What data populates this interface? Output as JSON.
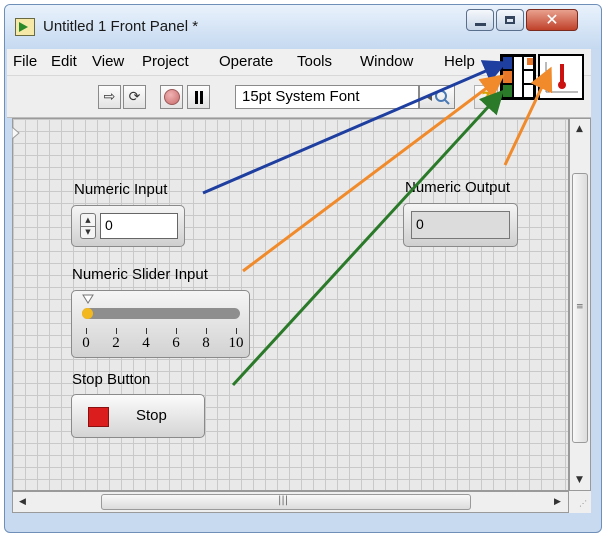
{
  "window": {
    "title": "Untitled 1 Front Panel *"
  },
  "menu": {
    "items": [
      "File",
      "Edit",
      "View",
      "Project",
      "Operate",
      "Tools",
      "Window",
      "Help"
    ]
  },
  "toolbar": {
    "run_icon": "run-arrow-icon",
    "run_continuous_icon": "run-continuously-icon",
    "abort_icon": "abort-execution-icon",
    "pause_icon": "pause-icon",
    "font": "15pt System Font",
    "search_icon": "search-icon",
    "help_icon": "context-help-icon"
  },
  "panel": {
    "numeric_input": {
      "label": "Numeric Input",
      "value": "0"
    },
    "numeric_output": {
      "label": "Numeric Output",
      "value": "0"
    },
    "slider": {
      "label": "Numeric Slider Input",
      "ticks": [
        "0",
        "2",
        "4",
        "6",
        "8",
        "10"
      ],
      "value": 0
    },
    "stop": {
      "label": "Stop Button",
      "text": "Stop"
    }
  },
  "annotation_colors": {
    "numeric_input": "#1f3fa0",
    "slider": "#f08a2a",
    "stop": "#2a7a2a",
    "output": "#f08a2a"
  },
  "connector_colors": {
    "blue": "#1f3fa0",
    "orange": "#e8772a",
    "green": "#2a7a2a"
  }
}
